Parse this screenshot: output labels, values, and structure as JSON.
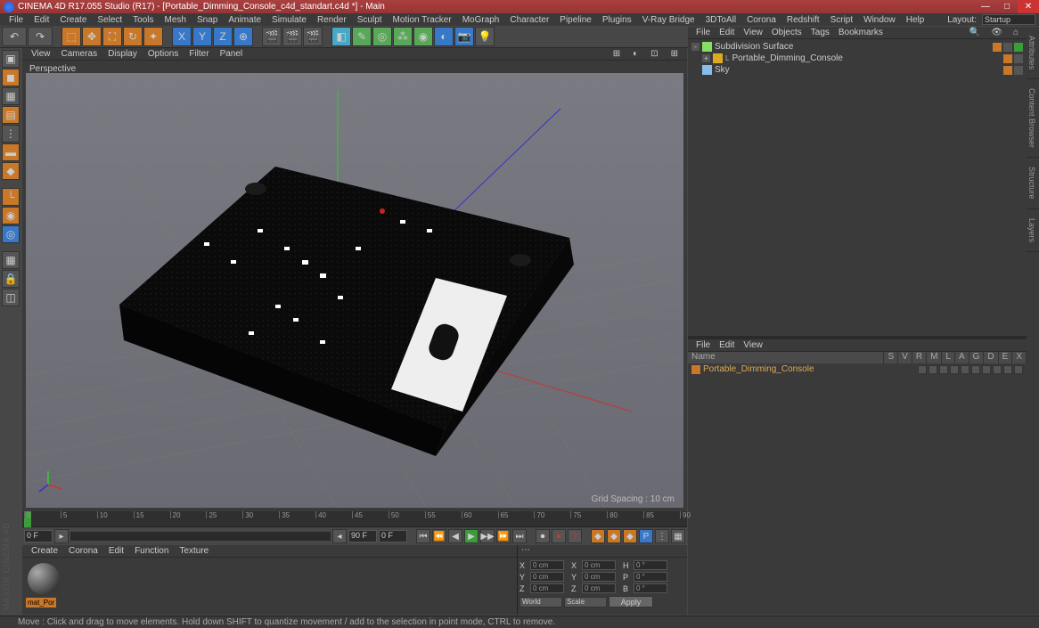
{
  "titlebar": "CINEMA 4D R17.055 Studio (R17) - [Portable_Dimming_Console_c4d_standart.c4d *] - Main",
  "menu": [
    "File",
    "Edit",
    "Create",
    "Select",
    "Tools",
    "Mesh",
    "Snap",
    "Animate",
    "Simulate",
    "Render",
    "Sculpt",
    "Motion Tracker",
    "MoGraph",
    "Character",
    "Pipeline",
    "Plugins",
    "V-Ray Bridge",
    "3DToAll",
    "Corona",
    "Redshift",
    "Script",
    "Window",
    "Help"
  ],
  "layout": {
    "label": "Layout:",
    "value": "Startup"
  },
  "viewport": {
    "menu": [
      "View",
      "Cameras",
      "Display",
      "Options",
      "Filter",
      "Panel"
    ],
    "label": "Perspective",
    "grid_info": "Grid Spacing : 10 cm"
  },
  "objects_panel": {
    "menu": [
      "File",
      "Edit",
      "View",
      "Objects",
      "Tags",
      "Bookmarks"
    ],
    "items": [
      {
        "indent": 0,
        "exp": "-",
        "name": "Subdivision Surface",
        "color": "#88dd66"
      },
      {
        "indent": 1,
        "exp": "+",
        "name": "Portable_Dimming_Console",
        "color": "#ddaa22",
        "prefix": "L"
      },
      {
        "indent": 0,
        "exp": "",
        "name": "Sky",
        "color": "#88bbee"
      }
    ]
  },
  "attrs_panel": {
    "menu": [
      "File",
      "Edit",
      "View"
    ],
    "cols": [
      "Name",
      "S",
      "V",
      "R",
      "M",
      "L",
      "A",
      "G",
      "D",
      "E",
      "X"
    ],
    "item": "Portable_Dimming_Console"
  },
  "right_tabs": [
    "Attributes",
    "Content Browser",
    "Structure",
    "Layers"
  ],
  "timeline": {
    "start": "0 F",
    "end": "90 F",
    "current": "0 F",
    "ticks": [
      0,
      5,
      10,
      15,
      20,
      25,
      30,
      35,
      40,
      45,
      50,
      55,
      60,
      65,
      70,
      75,
      80,
      85,
      90
    ]
  },
  "materials": {
    "menu": [
      "Create",
      "Corona",
      "Edit",
      "Function",
      "Texture"
    ],
    "name": "mat_Por"
  },
  "coordinates": {
    "rows": [
      {
        "a": "X",
        "v1": "0 cm",
        "b": "X",
        "v2": "0 cm",
        "c": "H",
        "v3": "0 °"
      },
      {
        "a": "Y",
        "v1": "0 cm",
        "b": "Y",
        "v2": "0 cm",
        "c": "P",
        "v3": "0 °"
      },
      {
        "a": "Z",
        "v1": "0 cm",
        "b": "Z",
        "v2": "0 cm",
        "c": "B",
        "v3": "0 °"
      }
    ],
    "sel1": "World",
    "sel2": "Scale",
    "apply": "Apply"
  },
  "statusbar": "Move : Click and drag to move elements. Hold down SHIFT to quantize movement / add to the selection in point mode, CTRL to remove.",
  "logo": "MAXON CINEMA 4D"
}
